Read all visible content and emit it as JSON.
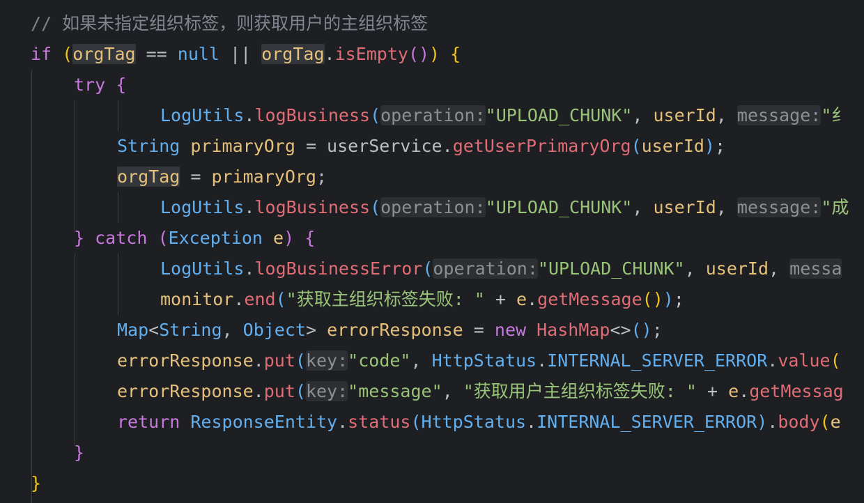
{
  "editor": {
    "theme": {
      "background": "#1e1f22",
      "guide": "#3a3c41",
      "hint_bg": "#2d2f33",
      "hint_fg": "#8c8f94",
      "keyword": "#c678dd",
      "type": "#61afef",
      "func": "#e06c75",
      "var": "#e5c07b",
      "string": "#98c379",
      "comment": "#7f848e",
      "brace_outer": "#f0c419",
      "brace_inner": "#c678dd",
      "paren": "#61afef",
      "plain": "#bcbec4"
    },
    "lines": [
      {
        "indent": 0,
        "tokens": [
          {
            "t": "// 如果未指定组织标签，则获取用户的主组织标签",
            "k": "comment"
          }
        ]
      },
      {
        "indent": 0,
        "tokens": [
          {
            "t": "if",
            "k": "keyword"
          },
          {
            "t": " ",
            "k": "plain"
          },
          {
            "t": "(",
            "k": "brace_outer"
          },
          {
            "t": "orgTag",
            "k": "var",
            "bg": true
          },
          {
            "t": " == ",
            "k": "plain"
          },
          {
            "t": "null",
            "k": "type"
          },
          {
            "t": " || ",
            "k": "plain"
          },
          {
            "t": "orgTag",
            "k": "var",
            "bg": true
          },
          {
            "t": ".",
            "k": "plain"
          },
          {
            "t": "isEmpty",
            "k": "func"
          },
          {
            "t": "()",
            "k": "brace_inner"
          },
          {
            "t": ")",
            "k": "brace_outer"
          },
          {
            "t": " ",
            "k": "plain"
          },
          {
            "t": "{",
            "k": "brace_outer"
          }
        ]
      },
      {
        "indent": 1,
        "tokens": [
          {
            "t": "try",
            "k": "keyword"
          },
          {
            "t": " ",
            "k": "plain"
          },
          {
            "t": "{",
            "k": "brace_inner"
          }
        ]
      },
      {
        "indent": 3,
        "tokens": [
          {
            "t": "LogUtils",
            "k": "type"
          },
          {
            "t": ".",
            "k": "plain"
          },
          {
            "t": "logBusiness",
            "k": "func"
          },
          {
            "t": "(",
            "k": "paren"
          },
          {
            "t": "operation:",
            "k": "hint"
          },
          {
            "t": "\"UPLOAD_CHUNK\"",
            "k": "string"
          },
          {
            "t": ", ",
            "k": "plain"
          },
          {
            "t": "userId",
            "k": "var"
          },
          {
            "t": ", ",
            "k": "plain"
          },
          {
            "t": "message:",
            "k": "hint"
          },
          {
            "t": "\"纟",
            "k": "string"
          }
        ]
      },
      {
        "indent": 2,
        "tokens": [
          {
            "t": "String",
            "k": "type"
          },
          {
            "t": " ",
            "k": "plain"
          },
          {
            "t": "primaryOrg",
            "k": "var"
          },
          {
            "t": " = ",
            "k": "plain"
          },
          {
            "t": "userService",
            "k": "plain"
          },
          {
            "t": ".",
            "k": "plain"
          },
          {
            "t": "getUserPrimaryOrg",
            "k": "func"
          },
          {
            "t": "(",
            "k": "paren"
          },
          {
            "t": "userId",
            "k": "var"
          },
          {
            "t": ")",
            "k": "paren"
          },
          {
            "t": ";",
            "k": "plain"
          }
        ]
      },
      {
        "indent": 2,
        "tokens": [
          {
            "t": "orgTag",
            "k": "var",
            "bg": true
          },
          {
            "t": " = ",
            "k": "plain"
          },
          {
            "t": "primaryOrg",
            "k": "var"
          },
          {
            "t": ";",
            "k": "plain"
          }
        ]
      },
      {
        "indent": 3,
        "tokens": [
          {
            "t": "LogUtils",
            "k": "type"
          },
          {
            "t": ".",
            "k": "plain"
          },
          {
            "t": "logBusiness",
            "k": "func"
          },
          {
            "t": "(",
            "k": "paren"
          },
          {
            "t": "operation:",
            "k": "hint"
          },
          {
            "t": "\"UPLOAD_CHUNK\"",
            "k": "string"
          },
          {
            "t": ", ",
            "k": "plain"
          },
          {
            "t": "userId",
            "k": "var"
          },
          {
            "t": ", ",
            "k": "plain"
          },
          {
            "t": "message:",
            "k": "hint"
          },
          {
            "t": "\"成",
            "k": "string"
          }
        ]
      },
      {
        "indent": 1,
        "tokens": [
          {
            "t": "}",
            "k": "brace_inner"
          },
          {
            "t": " ",
            "k": "plain"
          },
          {
            "t": "catch",
            "k": "keyword"
          },
          {
            "t": " ",
            "k": "plain"
          },
          {
            "t": "(",
            "k": "brace_inner"
          },
          {
            "t": "Exception",
            "k": "type"
          },
          {
            "t": " ",
            "k": "plain"
          },
          {
            "t": "e",
            "k": "var"
          },
          {
            "t": ")",
            "k": "brace_inner"
          },
          {
            "t": " ",
            "k": "plain"
          },
          {
            "t": "{",
            "k": "brace_inner"
          }
        ]
      },
      {
        "indent": 3,
        "tokens": [
          {
            "t": "LogUtils",
            "k": "type"
          },
          {
            "t": ".",
            "k": "plain"
          },
          {
            "t": "logBusinessError",
            "k": "func"
          },
          {
            "t": "(",
            "k": "paren"
          },
          {
            "t": "operation:",
            "k": "hint"
          },
          {
            "t": "\"UPLOAD_CHUNK\"",
            "k": "string"
          },
          {
            "t": ", ",
            "k": "plain"
          },
          {
            "t": "userId",
            "k": "var"
          },
          {
            "t": ", ",
            "k": "plain"
          },
          {
            "t": "messa",
            "k": "hint"
          }
        ]
      },
      {
        "indent": 3,
        "tokens": [
          {
            "t": "monitor",
            "k": "var"
          },
          {
            "t": ".",
            "k": "plain"
          },
          {
            "t": "end",
            "k": "func"
          },
          {
            "t": "(",
            "k": "paren"
          },
          {
            "t": "\"获取主组织标签失败: \"",
            "k": "string"
          },
          {
            "t": " + ",
            "k": "plain"
          },
          {
            "t": "e",
            "k": "var"
          },
          {
            "t": ".",
            "k": "plain"
          },
          {
            "t": "getMessage",
            "k": "func"
          },
          {
            "t": "()",
            "k": "brace_outer"
          },
          {
            "t": ")",
            "k": "paren"
          },
          {
            "t": ";",
            "k": "plain"
          }
        ]
      },
      {
        "indent": 2,
        "tokens": [
          {
            "t": "Map",
            "k": "type"
          },
          {
            "t": "<",
            "k": "plain"
          },
          {
            "t": "String",
            "k": "type"
          },
          {
            "t": ", ",
            "k": "plain"
          },
          {
            "t": "Object",
            "k": "type"
          },
          {
            "t": "> ",
            "k": "plain"
          },
          {
            "t": "errorResponse",
            "k": "var"
          },
          {
            "t": " = ",
            "k": "plain"
          },
          {
            "t": "new",
            "k": "keyword"
          },
          {
            "t": " ",
            "k": "plain"
          },
          {
            "t": "HashMap",
            "k": "func"
          },
          {
            "t": "<>",
            "k": "plain"
          },
          {
            "t": "()",
            "k": "paren"
          },
          {
            "t": ";",
            "k": "plain"
          }
        ]
      },
      {
        "indent": 2,
        "tokens": [
          {
            "t": "errorResponse",
            "k": "var"
          },
          {
            "t": ".",
            "k": "plain"
          },
          {
            "t": "put",
            "k": "func"
          },
          {
            "t": "(",
            "k": "paren"
          },
          {
            "t": "key:",
            "k": "hint"
          },
          {
            "t": "\"code\"",
            "k": "string"
          },
          {
            "t": ", ",
            "k": "plain"
          },
          {
            "t": "HttpStatus",
            "k": "type"
          },
          {
            "t": ".",
            "k": "plain"
          },
          {
            "t": "INTERNAL_SERVER_ERROR",
            "k": "type"
          },
          {
            "t": ".",
            "k": "plain"
          },
          {
            "t": "value",
            "k": "func"
          },
          {
            "t": "(",
            "k": "brace_outer"
          }
        ]
      },
      {
        "indent": 2,
        "tokens": [
          {
            "t": "errorResponse",
            "k": "var"
          },
          {
            "t": ".",
            "k": "plain"
          },
          {
            "t": "put",
            "k": "func"
          },
          {
            "t": "(",
            "k": "paren"
          },
          {
            "t": "key:",
            "k": "hint"
          },
          {
            "t": "\"message\"",
            "k": "string"
          },
          {
            "t": ", ",
            "k": "plain"
          },
          {
            "t": "\"获取用户主组织标签失败: \"",
            "k": "string"
          },
          {
            "t": " + ",
            "k": "plain"
          },
          {
            "t": "e",
            "k": "var"
          },
          {
            "t": ".",
            "k": "plain"
          },
          {
            "t": "getMessag",
            "k": "func"
          }
        ]
      },
      {
        "indent": 2,
        "tokens": [
          {
            "t": "return",
            "k": "keyword"
          },
          {
            "t": " ",
            "k": "plain"
          },
          {
            "t": "ResponseEntity",
            "k": "type"
          },
          {
            "t": ".",
            "k": "plain"
          },
          {
            "t": "status",
            "k": "func"
          },
          {
            "t": "(",
            "k": "paren"
          },
          {
            "t": "HttpStatus",
            "k": "type"
          },
          {
            "t": ".",
            "k": "plain"
          },
          {
            "t": "INTERNAL_SERVER_ERROR",
            "k": "type"
          },
          {
            "t": ")",
            "k": "paren"
          },
          {
            "t": ".",
            "k": "plain"
          },
          {
            "t": "body",
            "k": "func"
          },
          {
            "t": "(",
            "k": "brace_outer"
          },
          {
            "t": "e",
            "k": "var"
          }
        ]
      },
      {
        "indent": 1,
        "tokens": [
          {
            "t": "}",
            "k": "brace_inner"
          }
        ]
      },
      {
        "indent": 0,
        "tokens": [
          {
            "t": "}",
            "k": "brace_outer"
          }
        ]
      }
    ]
  }
}
